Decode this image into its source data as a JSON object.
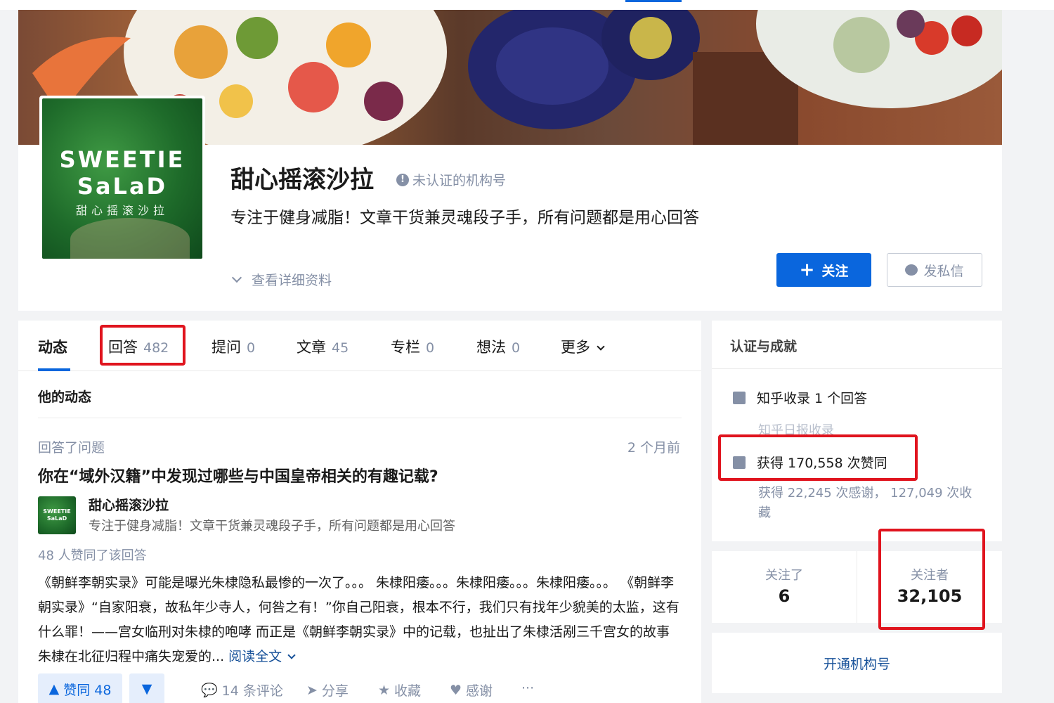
{
  "colors": {
    "brand_blue": "#0a66dd",
    "highlight_red": "#e0141e",
    "muted_text": "#8590a6"
  },
  "profile": {
    "name": "甜心摇滚沙拉",
    "badge": "未认证的机构号",
    "headline": "专注于健身减脂！文章干货兼灵魂段子手，所有问题都是用心回答",
    "detail_link": "查看详细资料",
    "logo_line1": "SWEETIE",
    "logo_line2": "SaLaD",
    "logo_line3": "甜心摇滚沙拉",
    "follow_label": "关注",
    "message_label": "发私信"
  },
  "tabs": [
    {
      "label": "动态",
      "count": ""
    },
    {
      "label": "回答",
      "count": "482"
    },
    {
      "label": "提问",
      "count": "0"
    },
    {
      "label": "文章",
      "count": "45"
    },
    {
      "label": "专栏",
      "count": "0"
    },
    {
      "label": "想法",
      "count": "0"
    },
    {
      "label": "更多",
      "count": ""
    }
  ],
  "feed": {
    "section_title": "他的动态",
    "item": {
      "action": "回答了问题",
      "time": "2 个月前",
      "question": "你在“域外汉籍”中发现过哪些与中国皇帝相关的有趣记载?",
      "author_name": "甜心摇滚沙拉",
      "author_headline": "专注于健身减脂！文章干货兼灵魂段子手，所有问题都是用心回答",
      "votes_line": "48 人赞同了该回答",
      "excerpt": "《朝鲜李朝实录》可能是曝光朱棣隐私最惨的一次了。。。 朱棣阳痿。。。朱棣阳痿。。。朱棣阳痿。。。 《朝鲜李朝实录》“自家阳衰，故私年少寺人，何咎之有！”你自己阳衰，根本不行，我们只有找年少貌美的太监，这有什么罪！——宫女临刑对朱棣的咆哮 而正是《朝鲜李朝实录》中的记载，也扯出了朱棣活剐三千宫女的故事 朱棣在北征归程中痛失宠爱的...",
      "read_more": "阅读全文",
      "vote_label": "赞同 48",
      "comments": "14 条评论",
      "share": "分享",
      "collect": "收藏",
      "thanks": "感谢",
      "more": "···"
    }
  },
  "achievements": {
    "title": "认证与成就",
    "included": "知乎收录 1 个回答",
    "daily": "知乎日报收录",
    "upvotes": "获得 170,558 次赞同",
    "thanks_collect": "获得 22,245 次感谢， 127,049 次收藏"
  },
  "follow_stats": {
    "following_label": "关注了",
    "following_count": "6",
    "followers_label": "关注者",
    "followers_count": "32,105"
  },
  "open_org": "开通机构号"
}
